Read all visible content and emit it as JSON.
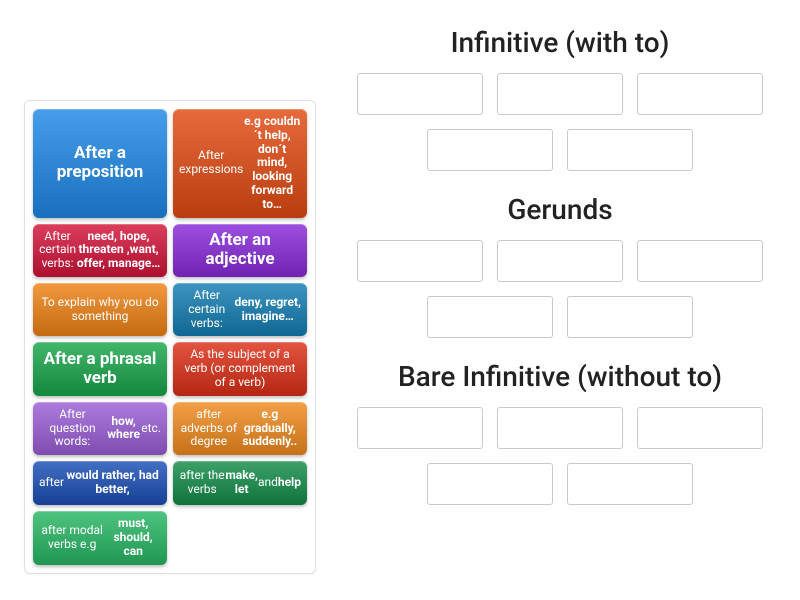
{
  "tray": {
    "cards": [
      {
        "id": "c1",
        "html": "After a preposition",
        "color": "#1e88e5",
        "big": true
      },
      {
        "id": "c2",
        "html": "After expressions <b>e.g couldn´t help, don´t mind, looking forward to…</b>",
        "color": "#e24a12",
        "big": false
      },
      {
        "id": "c3",
        "html": "After certain verbs: <b>need, hope, threaten ,want, offer, manage…</b>",
        "color": "#d4133a",
        "big": false
      },
      {
        "id": "c4",
        "html": "After an adjective",
        "color": "#8829d9",
        "big": true
      },
      {
        "id": "c5",
        "html": "To explain why you do something",
        "color": "#ef8214",
        "big": false
      },
      {
        "id": "c6",
        "html": "After certain verbs: <b>deny, regret, imagine…</b>",
        "color": "#137db3",
        "big": false
      },
      {
        "id": "c7",
        "html": "After a phrasal verb",
        "color": "#18a64a",
        "big": true
      },
      {
        "id": "c8",
        "html": "As the subject of a verb (or complement of a verb)",
        "color": "#dd2f16",
        "big": false
      },
      {
        "id": "c9",
        "html": "After question words: <b>how, where</b> etc.",
        "color": "#9a5ed6",
        "big": false
      },
      {
        "id": "c10",
        "html": "after adverbs of degree <b>e.g gradually, suddenly..</b>",
        "color": "#f08a1e",
        "big": false
      },
      {
        "id": "c11",
        "html": "after <b>would rather, had better,</b>",
        "color": "#1a4fb5",
        "big": false
      },
      {
        "id": "c12",
        "html": "after the verbs <b>make, let</b> and <b>help</b>",
        "color": "#128c49",
        "big": false
      },
      {
        "id": "c13",
        "html": "after modal verbs e.g <b>must, should, can</b>",
        "color": "#28b765",
        "big": false
      }
    ]
  },
  "categories": [
    {
      "id": "infinitive_to",
      "title": "Infinitive (with to)",
      "slot_count": 5
    },
    {
      "id": "gerunds",
      "title": "Gerunds",
      "slot_count": 5
    },
    {
      "id": "bare_infinitive",
      "title": "Bare Infinitive (without to)",
      "slot_count": 5
    }
  ]
}
